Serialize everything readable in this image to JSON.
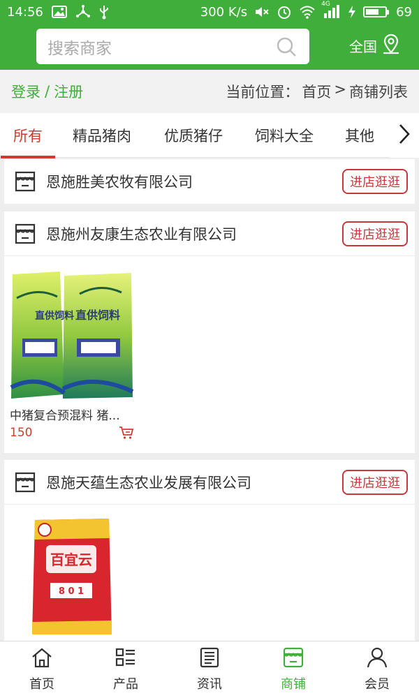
{
  "status_bar": {
    "time": "14:56",
    "network_speed": "300 K/s",
    "network_type": "4G",
    "battery_level": "69",
    "battery_fraction": 0.69,
    "icons": [
      "image-icon",
      "usb-share-icon",
      "usb-icon",
      "mute-icon",
      "alarm-icon",
      "wifi-icon",
      "signal-icon",
      "charging-icon",
      "battery-icon"
    ]
  },
  "header": {
    "search_placeholder": "搜索商家",
    "region_label": "全国",
    "brand_color": "#3fae3a"
  },
  "crumbbar": {
    "login_label": "登录",
    "separator": "/",
    "register_label": "注册",
    "location_prefix": "当前位置：",
    "home_label": "首页",
    "crumb_sep": ">",
    "current_label": "商铺列表"
  },
  "tabs": {
    "items": [
      {
        "label": "所有"
      },
      {
        "label": "精品猪肉"
      },
      {
        "label": "优质猪仔"
      },
      {
        "label": "饲料大全"
      },
      {
        "label": "其他"
      }
    ],
    "active_color": "#d33a2c"
  },
  "shops": [
    {
      "name": "恩施胜美农牧有限公司",
      "visit_label": "进店逛逛",
      "products": []
    },
    {
      "name": "恩施州友康生态农业有限公司",
      "visit_label": "进店逛逛",
      "products": [
        {
          "title": "中猪复合预混料 猪...",
          "price": "150"
        }
      ]
    },
    {
      "name": "恩施天蕴生态农业发展有限公司",
      "visit_label": "进店逛逛",
      "products": [
        {
          "title": "",
          "price": ""
        }
      ]
    }
  ],
  "product_art": {
    "feed_bag_text": "直供饲料",
    "red_bag_text": "百宜云",
    "red_bag_badge": "8 0 1"
  },
  "bottom_nav": {
    "items": [
      {
        "label": "首页",
        "icon": "home-icon"
      },
      {
        "label": "产品",
        "icon": "product-grid-icon"
      },
      {
        "label": "资讯",
        "icon": "news-icon"
      },
      {
        "label": "商铺",
        "icon": "store-icon"
      },
      {
        "label": "会员",
        "icon": "user-icon"
      }
    ],
    "active_index": 3
  }
}
